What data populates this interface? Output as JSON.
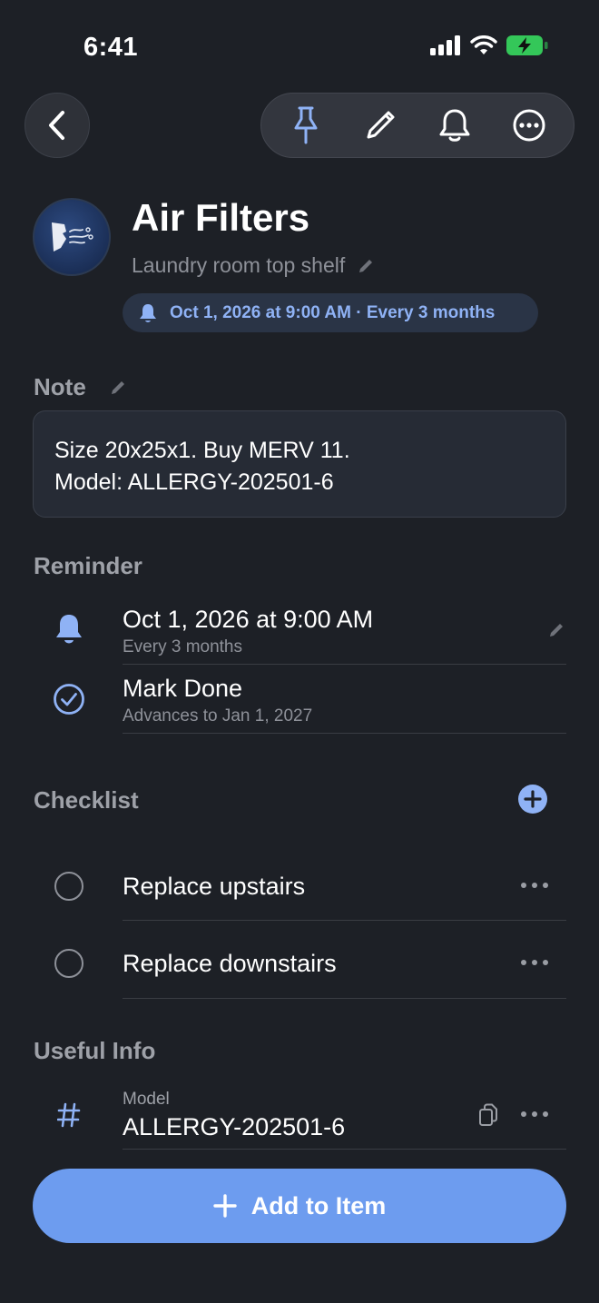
{
  "status_bar": {
    "time": "6:41"
  },
  "header": {
    "title": "Air Filters",
    "location": "Laundry room top shelf",
    "reminder_pill": "Oct 1, 2026 at 9:00 AM · Every 3 months"
  },
  "note": {
    "label": "Note",
    "line1": "Size 20x25x1. Buy MERV 11.",
    "line2": "Model: ALLERGY-202501-6"
  },
  "reminder": {
    "label": "Reminder",
    "date": "Oct 1, 2026 at 9:00 AM",
    "repeat": "Every 3 months",
    "mark_done": "Mark Done",
    "advances": "Advances to Jan 1, 2027"
  },
  "checklist": {
    "label": "Checklist",
    "items": [
      {
        "label": "Replace upstairs"
      },
      {
        "label": "Replace downstairs"
      }
    ]
  },
  "useful_info": {
    "label": "Useful Info",
    "field_label": "Model",
    "field_value": "ALLERGY-202501-6"
  },
  "footer": {
    "add_label": "Add to Item"
  },
  "colors": {
    "accent": "#6d9cef",
    "background": "#1d2026",
    "pill_text": "#8fb2f5"
  },
  "icons": [
    "back-icon",
    "pin-icon",
    "pencil-icon",
    "bell-icon",
    "more-icon",
    "check-circle-icon",
    "plus-icon",
    "hash-icon",
    "copy-icon"
  ]
}
